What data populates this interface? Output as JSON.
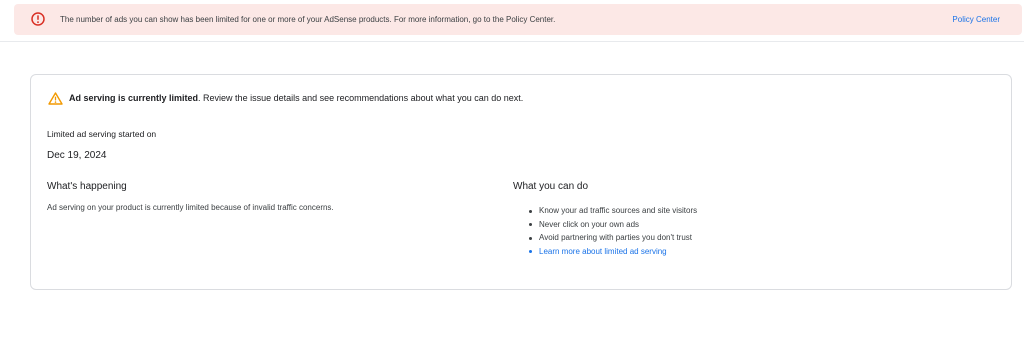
{
  "banner": {
    "message": "The number of ads you can show has been limited for one or more of your AdSense products. For more information, go to the Policy Center.",
    "link_label": "Policy Center",
    "icon": "error-circle-icon",
    "accent_color": "#d93025",
    "background_color": "#fce8e6"
  },
  "card": {
    "headline_bold": "Ad serving is currently limited",
    "headline_rest": ". Review the issue details and see recommendations about what you can do next.",
    "warning_icon": "warning-triangle-icon",
    "warning_color": "#f29900",
    "started_label": "Limited ad serving started on",
    "started_date": "Dec 19, 2024",
    "happening": {
      "title": "What's happening",
      "text": "Ad serving on your product is currently limited because of invalid traffic concerns."
    },
    "todo": {
      "title": "What you can do",
      "items": [
        "Know your ad traffic sources and site visitors",
        "Never click on your own ads",
        "Avoid partnering with parties you don't trust"
      ],
      "link_label": "Learn more about limited ad serving",
      "link_color": "#1a73e8"
    }
  }
}
